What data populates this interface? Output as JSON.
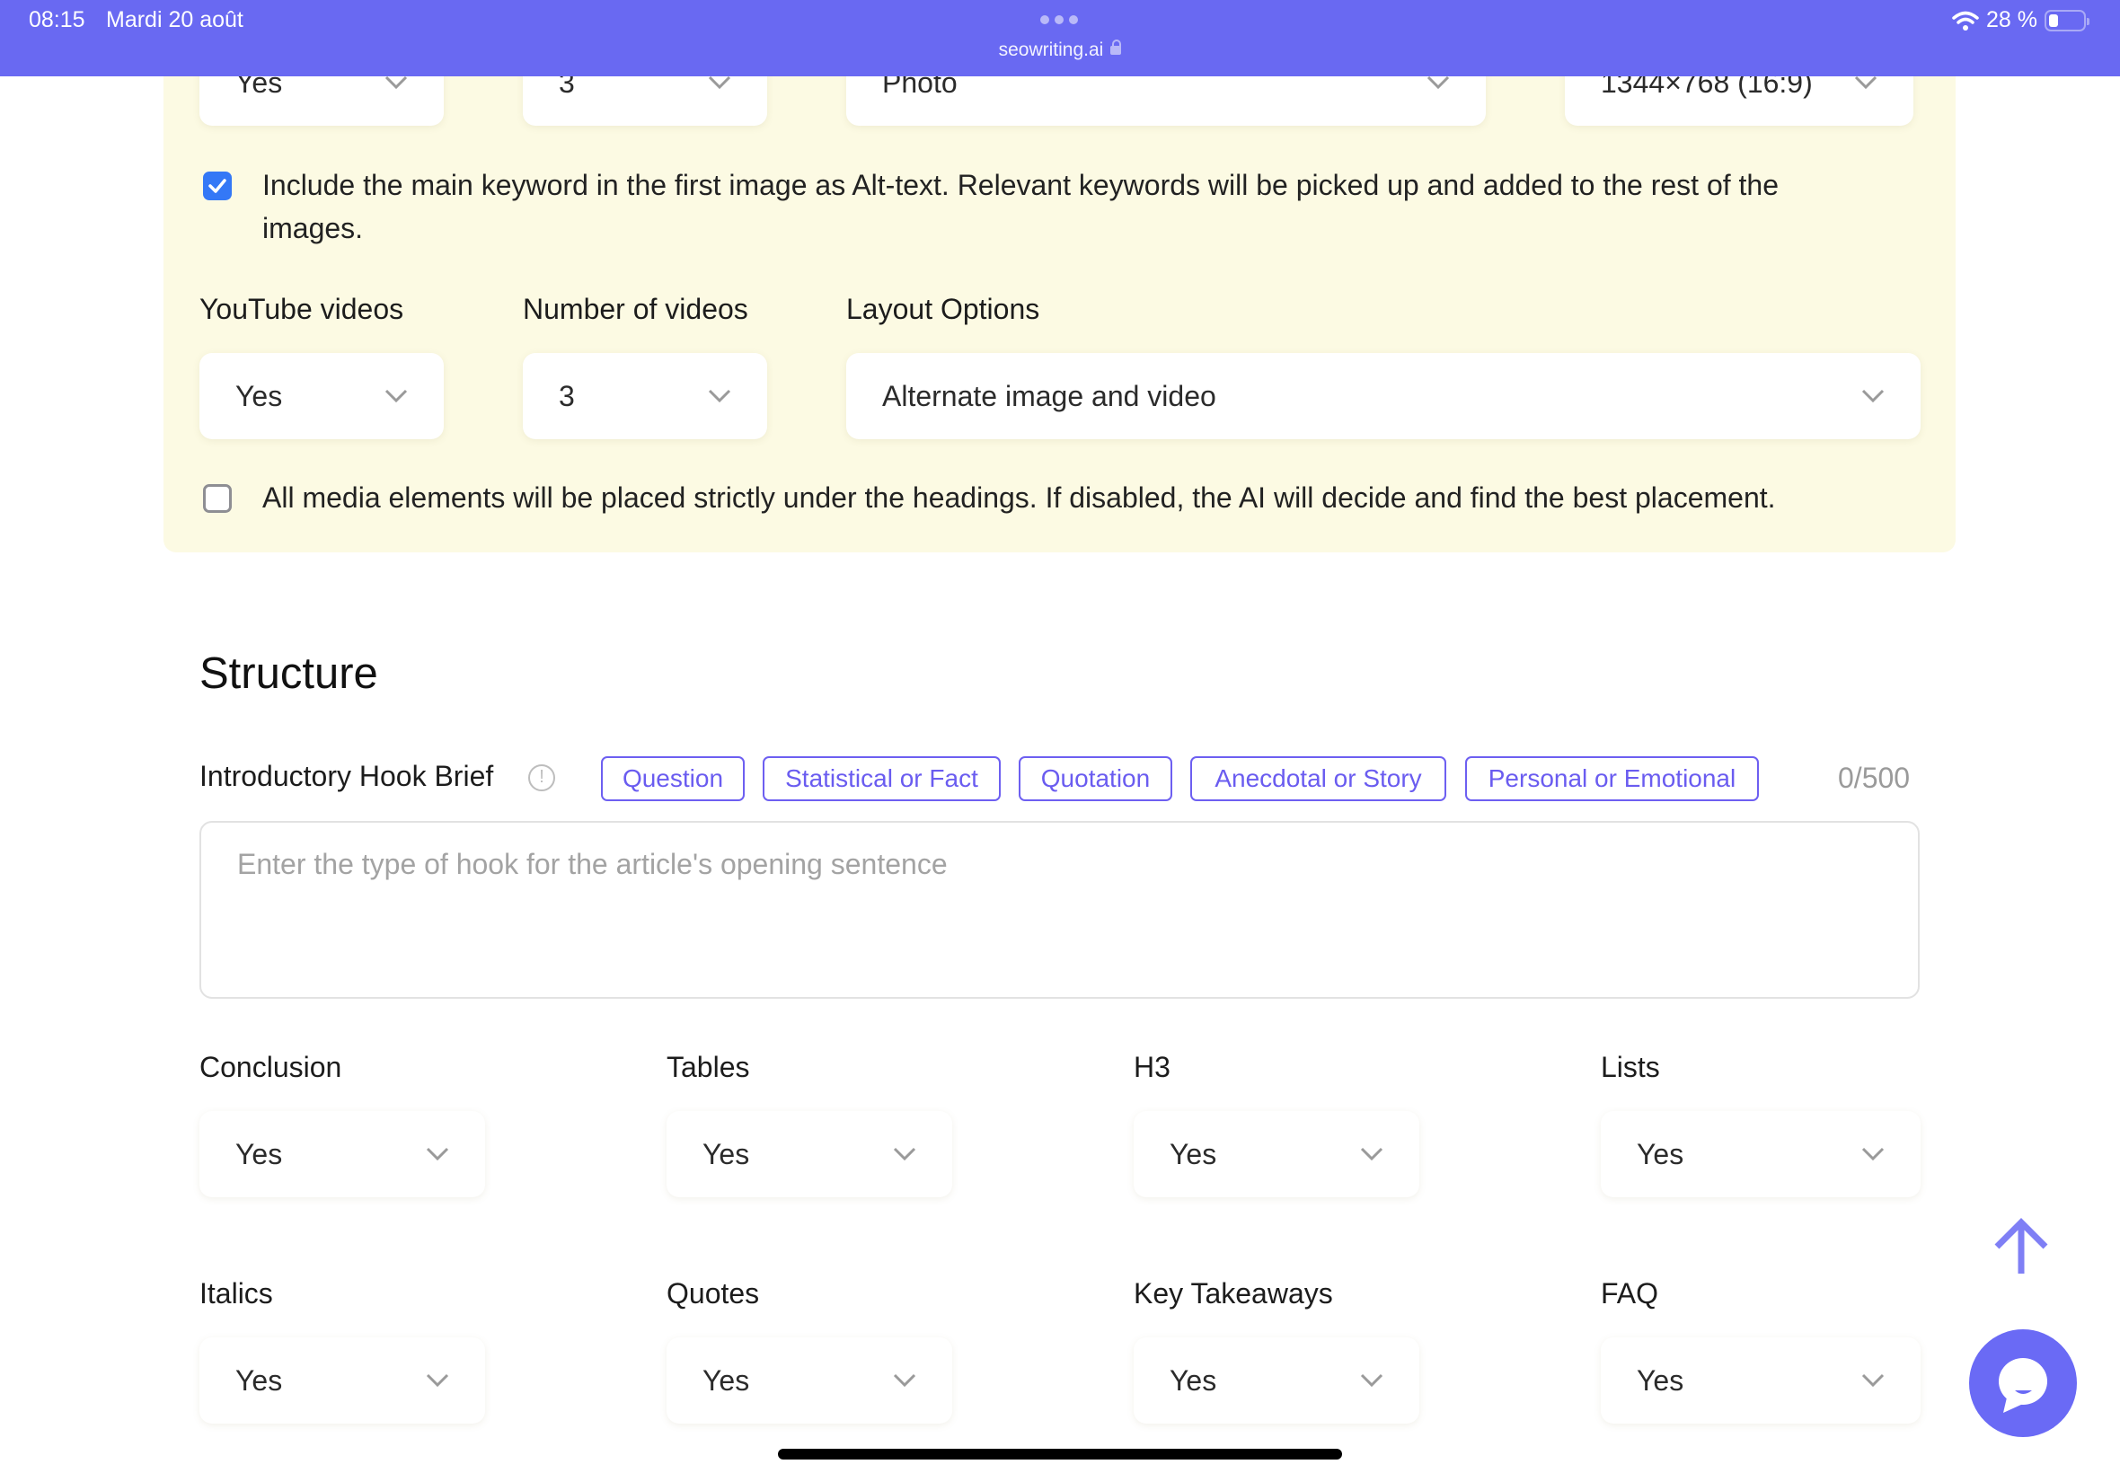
{
  "status_bar": {
    "time": "08:15",
    "date": "Mardi 20 août",
    "url": "seowriting.ai",
    "battery": "28 %",
    "battery_level": 0.28
  },
  "colors": {
    "accent": "#6969F2",
    "panel_bg": "#FCFAE3",
    "chip_border": "#6D5FF1",
    "checkbox_checked": "#3478F6"
  },
  "media_panel": {
    "top_selects": [
      {
        "value": "Yes"
      },
      {
        "value": "3"
      },
      {
        "value": "Photo"
      },
      {
        "value": "1344×768 (16:9)"
      }
    ],
    "alt_text_checkbox": {
      "checked": true,
      "line1": "Include the main keyword in the first image as Alt-text. Relevant keywords will be picked up and added to the rest of the",
      "line2": "images."
    },
    "youtube_label": "YouTube videos",
    "youtube_value": "Yes",
    "num_videos_label": "Number of videos",
    "num_videos_value": "3",
    "layout_label": "Layout Options",
    "layout_value": "Alternate image and video",
    "placement_checkbox": {
      "checked": false,
      "text": "All media elements will be placed strictly under the headings. If disabled, the AI will decide and find the best placement."
    }
  },
  "structure": {
    "title": "Structure",
    "hook_label": "Introductory Hook Brief",
    "hook_chips": [
      "Question",
      "Statistical or Fact",
      "Quotation",
      "Anecdotal or Story",
      "Personal or Emotional"
    ],
    "hook_counter": "0/500",
    "hook_placeholder": "Enter the type of hook for the article's opening sentence",
    "options": [
      {
        "label": "Conclusion",
        "value": "Yes"
      },
      {
        "label": "Tables",
        "value": "Yes"
      },
      {
        "label": "H3",
        "value": "Yes"
      },
      {
        "label": "Lists",
        "value": "Yes"
      },
      {
        "label": "Italics",
        "value": "Yes"
      },
      {
        "label": "Quotes",
        "value": "Yes"
      },
      {
        "label": "Key Takeaways",
        "value": "Yes"
      },
      {
        "label": "FAQ",
        "value": "Yes"
      }
    ]
  }
}
